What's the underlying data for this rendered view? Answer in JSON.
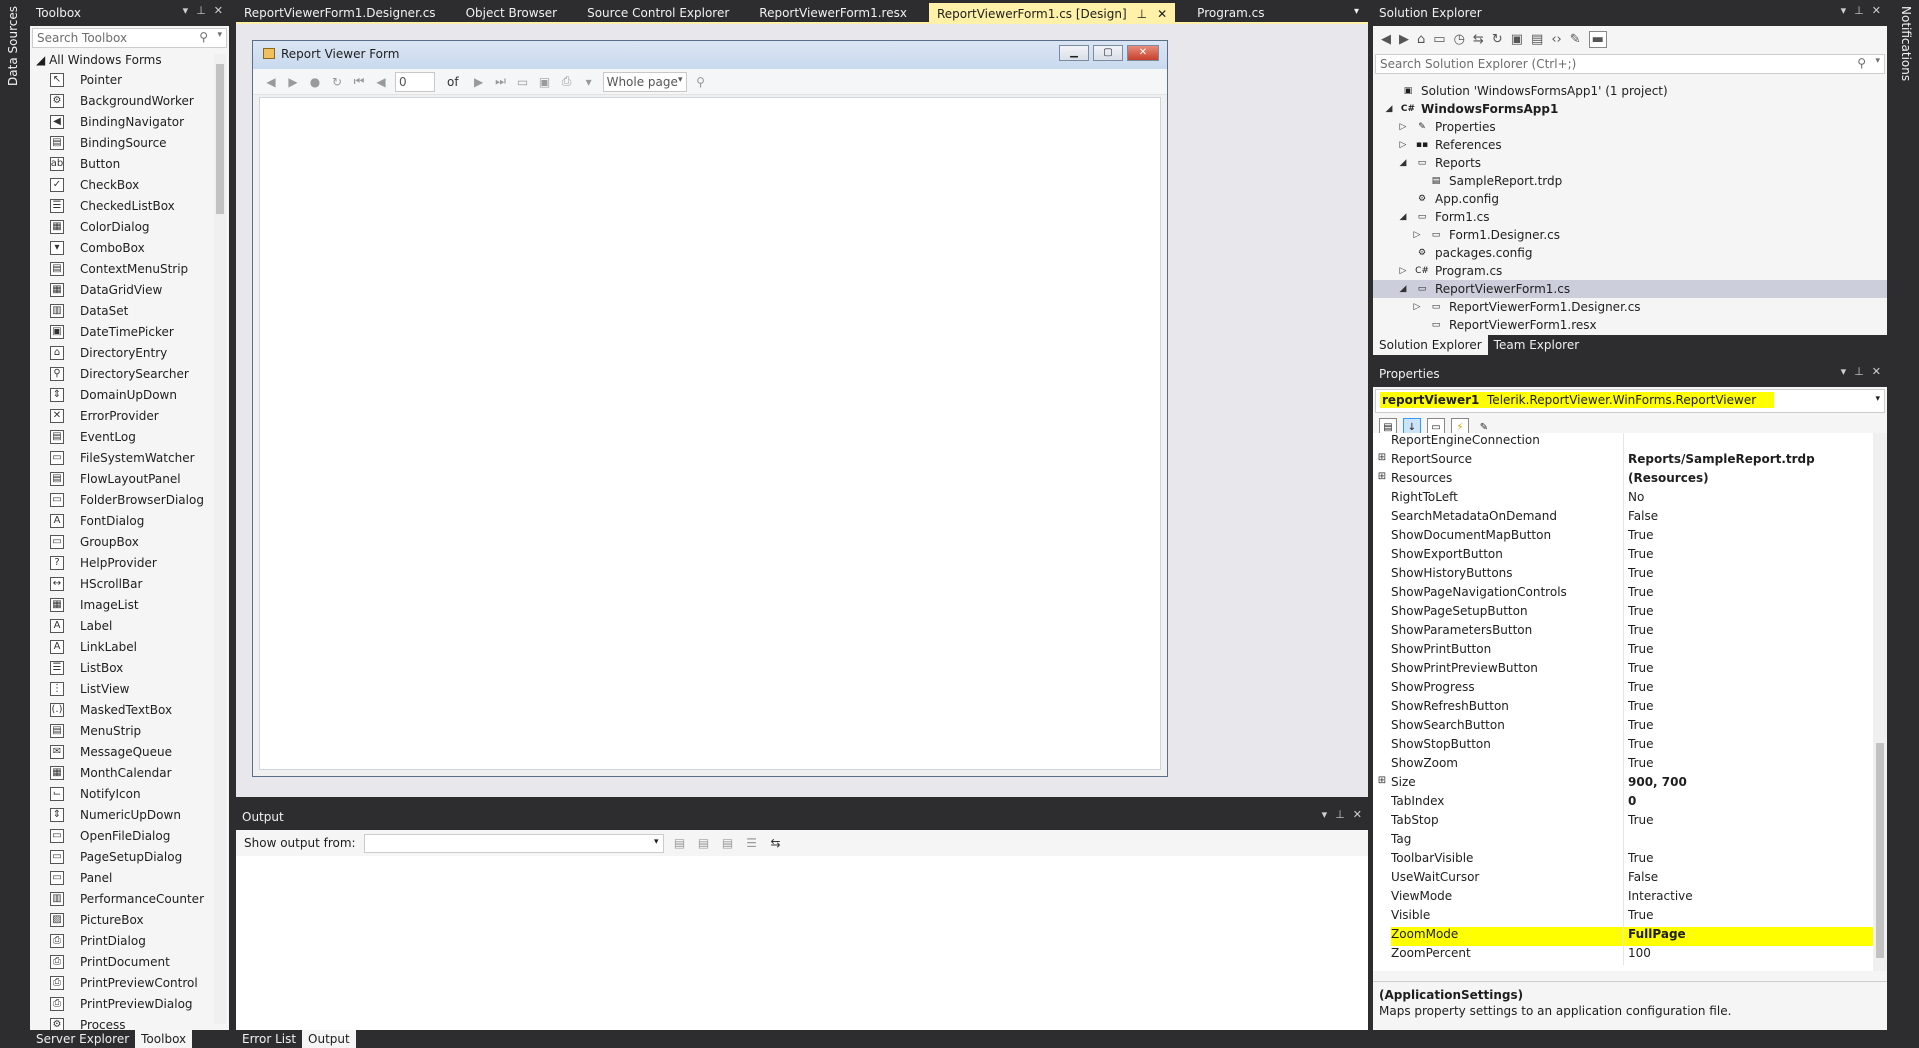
{
  "side_tabs": {
    "left": "Data Sources",
    "right": "Notifications"
  },
  "toolbox": {
    "title": "Toolbox",
    "search_placeholder": "Search Toolbox",
    "group": "All Windows Forms",
    "items": [
      {
        "label": "Pointer",
        "icon": "pointer-icon",
        "glyph": "↖"
      },
      {
        "label": "BackgroundWorker",
        "icon": "background-worker-icon",
        "glyph": "⚙"
      },
      {
        "label": "BindingNavigator",
        "icon": "binding-navigator-icon",
        "glyph": "◀"
      },
      {
        "label": "BindingSource",
        "icon": "binding-source-icon",
        "glyph": "▤"
      },
      {
        "label": "Button",
        "icon": "button-icon",
        "glyph": "ab"
      },
      {
        "label": "CheckBox",
        "icon": "checkbox-icon",
        "glyph": "✓"
      },
      {
        "label": "CheckedListBox",
        "icon": "checked-listbox-icon",
        "glyph": "☰"
      },
      {
        "label": "ColorDialog",
        "icon": "color-dialog-icon",
        "glyph": "▦"
      },
      {
        "label": "ComboBox",
        "icon": "combobox-icon",
        "glyph": "▾"
      },
      {
        "label": "ContextMenuStrip",
        "icon": "context-menu-icon",
        "glyph": "▤"
      },
      {
        "label": "DataGridView",
        "icon": "datagrid-icon",
        "glyph": "▦"
      },
      {
        "label": "DataSet",
        "icon": "dataset-icon",
        "glyph": "▥"
      },
      {
        "label": "DateTimePicker",
        "icon": "datetime-picker-icon",
        "glyph": "▣"
      },
      {
        "label": "DirectoryEntry",
        "icon": "directory-entry-icon",
        "glyph": "⌂"
      },
      {
        "label": "DirectorySearcher",
        "icon": "directory-searcher-icon",
        "glyph": "⚲"
      },
      {
        "label": "DomainUpDown",
        "icon": "domain-updown-icon",
        "glyph": "⇕"
      },
      {
        "label": "ErrorProvider",
        "icon": "error-provider-icon",
        "glyph": "✕"
      },
      {
        "label": "EventLog",
        "icon": "event-log-icon",
        "glyph": "▤"
      },
      {
        "label": "FileSystemWatcher",
        "icon": "filesystem-watcher-icon",
        "glyph": "▭"
      },
      {
        "label": "FlowLayoutPanel",
        "icon": "flow-layout-icon",
        "glyph": "▤"
      },
      {
        "label": "FolderBrowserDialog",
        "icon": "folder-browser-icon",
        "glyph": "▭"
      },
      {
        "label": "FontDialog",
        "icon": "font-dialog-icon",
        "glyph": "A"
      },
      {
        "label": "GroupBox",
        "icon": "groupbox-icon",
        "glyph": "▭"
      },
      {
        "label": "HelpProvider",
        "icon": "help-provider-icon",
        "glyph": "?"
      },
      {
        "label": "HScrollBar",
        "icon": "hscrollbar-icon",
        "glyph": "↔"
      },
      {
        "label": "ImageList",
        "icon": "imagelist-icon",
        "glyph": "▦"
      },
      {
        "label": "Label",
        "icon": "label-icon",
        "glyph": "A"
      },
      {
        "label": "LinkLabel",
        "icon": "linklabel-icon",
        "glyph": "A"
      },
      {
        "label": "ListBox",
        "icon": "listbox-icon",
        "glyph": "☰"
      },
      {
        "label": "ListView",
        "icon": "listview-icon",
        "glyph": "⋮"
      },
      {
        "label": "MaskedTextBox",
        "icon": "masked-textbox-icon",
        "glyph": "(.)"
      },
      {
        "label": "MenuStrip",
        "icon": "menustrip-icon",
        "glyph": "▤"
      },
      {
        "label": "MessageQueue",
        "icon": "message-queue-icon",
        "glyph": "✉"
      },
      {
        "label": "MonthCalendar",
        "icon": "month-calendar-icon",
        "glyph": "▦"
      },
      {
        "label": "NotifyIcon",
        "icon": "notify-icon",
        "glyph": "⌙"
      },
      {
        "label": "NumericUpDown",
        "icon": "numeric-updown-icon",
        "glyph": "⇕"
      },
      {
        "label": "OpenFileDialog",
        "icon": "open-file-dialog-icon",
        "glyph": "▭"
      },
      {
        "label": "PageSetupDialog",
        "icon": "page-setup-dialog-icon",
        "glyph": "▭"
      },
      {
        "label": "Panel",
        "icon": "panel-icon",
        "glyph": "▭"
      },
      {
        "label": "PerformanceCounter",
        "icon": "performance-counter-icon",
        "glyph": "▥"
      },
      {
        "label": "PictureBox",
        "icon": "picturebox-icon",
        "glyph": "▨"
      },
      {
        "label": "PrintDialog",
        "icon": "print-dialog-icon",
        "glyph": "⎙"
      },
      {
        "label": "PrintDocument",
        "icon": "print-document-icon",
        "glyph": "⎙"
      },
      {
        "label": "PrintPreviewControl",
        "icon": "print-preview-control-icon",
        "glyph": "⎙"
      },
      {
        "label": "PrintPreviewDialog",
        "icon": "print-preview-dialog-icon",
        "glyph": "⎙"
      },
      {
        "label": "Process",
        "icon": "process-icon",
        "glyph": "⚙"
      }
    ]
  },
  "left_bottom_tabs": [
    "Server Explorer",
    "Toolbox"
  ],
  "doc_tabs": [
    {
      "label": "ReportViewerForm1.Designer.cs",
      "active": false
    },
    {
      "label": "Object Browser",
      "active": false
    },
    {
      "label": "Source Control Explorer",
      "active": false
    },
    {
      "label": "ReportViewerForm1.resx",
      "active": false
    },
    {
      "label": "ReportViewerForm1.cs [Design]",
      "active": true
    },
    {
      "label": "Program.cs",
      "active": false
    }
  ],
  "form": {
    "title": "Report Viewer Form",
    "page_value": "0",
    "of_label": "of",
    "zoom_value": "Whole page"
  },
  "output": {
    "title": "Output",
    "show_from_label": "Show output from:",
    "source_value": ""
  },
  "output_bottom_tabs": [
    "Error List",
    "Output"
  ],
  "solution_explorer": {
    "title": "Solution Explorer",
    "search_placeholder": "Search Solution Explorer (Ctrl+;)",
    "tree": [
      {
        "label": "Solution 'WindowsFormsApp1' (1 project)",
        "depth": 0,
        "tri": "",
        "icon": "solution-icon",
        "glyph": "▣"
      },
      {
        "label": "WindowsFormsApp1",
        "depth": 0,
        "tri": "◢",
        "icon": "csharp-project-icon",
        "glyph": "C#",
        "bold": true
      },
      {
        "label": "Properties",
        "depth": 1,
        "tri": "▷",
        "icon": "wrench-icon",
        "glyph": "✎"
      },
      {
        "label": "References",
        "depth": 1,
        "tri": "▷",
        "icon": "references-icon",
        "glyph": "▪▪"
      },
      {
        "label": "Reports",
        "depth": 1,
        "tri": "◢",
        "icon": "folder-icon",
        "glyph": "▭"
      },
      {
        "label": "SampleReport.trdp",
        "depth": 2,
        "tri": "",
        "icon": "report-file-icon",
        "glyph": "▤"
      },
      {
        "label": "App.config",
        "depth": 1,
        "tri": "",
        "icon": "config-file-icon",
        "glyph": "⚙"
      },
      {
        "label": "Form1.cs",
        "depth": 1,
        "tri": "◢",
        "icon": "form-file-icon",
        "glyph": "▭"
      },
      {
        "label": "Form1.Designer.cs",
        "depth": 2,
        "tri": "▷",
        "icon": "designer-file-icon",
        "glyph": "▭"
      },
      {
        "label": "packages.config",
        "depth": 1,
        "tri": "",
        "icon": "config-file-icon",
        "glyph": "⚙"
      },
      {
        "label": "Program.cs",
        "depth": 1,
        "tri": "▷",
        "icon": "csharp-file-icon",
        "glyph": "C#"
      },
      {
        "label": "ReportViewerForm1.cs",
        "depth": 1,
        "tri": "◢",
        "icon": "form-file-icon",
        "glyph": "▭",
        "selected": true
      },
      {
        "label": "ReportViewerForm1.Designer.cs",
        "depth": 2,
        "tri": "▷",
        "icon": "designer-file-icon",
        "glyph": "▭"
      },
      {
        "label": "ReportViewerForm1.resx",
        "depth": 2,
        "tri": "",
        "icon": "resx-file-icon",
        "glyph": "▭"
      }
    ],
    "tabs": [
      "Solution Explorer",
      "Team Explorer"
    ]
  },
  "properties": {
    "title": "Properties",
    "object_name": "reportViewer1",
    "object_type": "Telerik.ReportViewer.WinForms.ReportViewer",
    "rows": [
      {
        "name": "ReportEngineConnection",
        "value": "",
        "expand": false,
        "bold": false
      },
      {
        "name": "ReportSource",
        "value": "Reports/SampleReport.trdp",
        "expand": true,
        "bold": true
      },
      {
        "name": "Resources",
        "value": "(Resources)",
        "expand": true,
        "bold": true
      },
      {
        "name": "RightToLeft",
        "value": "No",
        "expand": false,
        "bold": false
      },
      {
        "name": "SearchMetadataOnDemand",
        "value": "False",
        "expand": false,
        "bold": false
      },
      {
        "name": "ShowDocumentMapButton",
        "value": "True",
        "expand": false,
        "bold": false
      },
      {
        "name": "ShowExportButton",
        "value": "True",
        "expand": false,
        "bold": false
      },
      {
        "name": "ShowHistoryButtons",
        "value": "True",
        "expand": false,
        "bold": false
      },
      {
        "name": "ShowPageNavigationControls",
        "value": "True",
        "expand": false,
        "bold": false
      },
      {
        "name": "ShowPageSetupButton",
        "value": "True",
        "expand": false,
        "bold": false
      },
      {
        "name": "ShowParametersButton",
        "value": "True",
        "expand": false,
        "bold": false
      },
      {
        "name": "ShowPrintButton",
        "value": "True",
        "expand": false,
        "bold": false
      },
      {
        "name": "ShowPrintPreviewButton",
        "value": "True",
        "expand": false,
        "bold": false
      },
      {
        "name": "ShowProgress",
        "value": "True",
        "expand": false,
        "bold": false
      },
      {
        "name": "ShowRefreshButton",
        "value": "True",
        "expand": false,
        "bold": false
      },
      {
        "name": "ShowSearchButton",
        "value": "True",
        "expand": false,
        "bold": false
      },
      {
        "name": "ShowStopButton",
        "value": "True",
        "expand": false,
        "bold": false
      },
      {
        "name": "ShowZoom",
        "value": "True",
        "expand": false,
        "bold": false
      },
      {
        "name": "Size",
        "value": "900, 700",
        "expand": true,
        "bold": true
      },
      {
        "name": "TabIndex",
        "value": "0",
        "expand": false,
        "bold": true
      },
      {
        "name": "TabStop",
        "value": "True",
        "expand": false,
        "bold": false
      },
      {
        "name": "Tag",
        "value": "",
        "expand": false,
        "bold": false
      },
      {
        "name": "ToolbarVisible",
        "value": "True",
        "expand": false,
        "bold": false
      },
      {
        "name": "UseWaitCursor",
        "value": "False",
        "expand": false,
        "bold": false
      },
      {
        "name": "ViewMode",
        "value": "Interactive",
        "expand": false,
        "bold": false
      },
      {
        "name": "Visible",
        "value": "True",
        "expand": false,
        "bold": false
      },
      {
        "name": "ZoomMode",
        "value": "FullPage",
        "expand": false,
        "bold": true,
        "highlight": true
      },
      {
        "name": "ZoomPercent",
        "value": "100",
        "expand": false,
        "bold": false
      }
    ],
    "desc_title": "(ApplicationSettings)",
    "desc_text": "Maps property settings to an application configuration file."
  },
  "colors": {
    "highlight": "#ffff00",
    "chrome": "#2d2d30",
    "active_tab": "#fff1a8",
    "selection": "#cccedb"
  }
}
